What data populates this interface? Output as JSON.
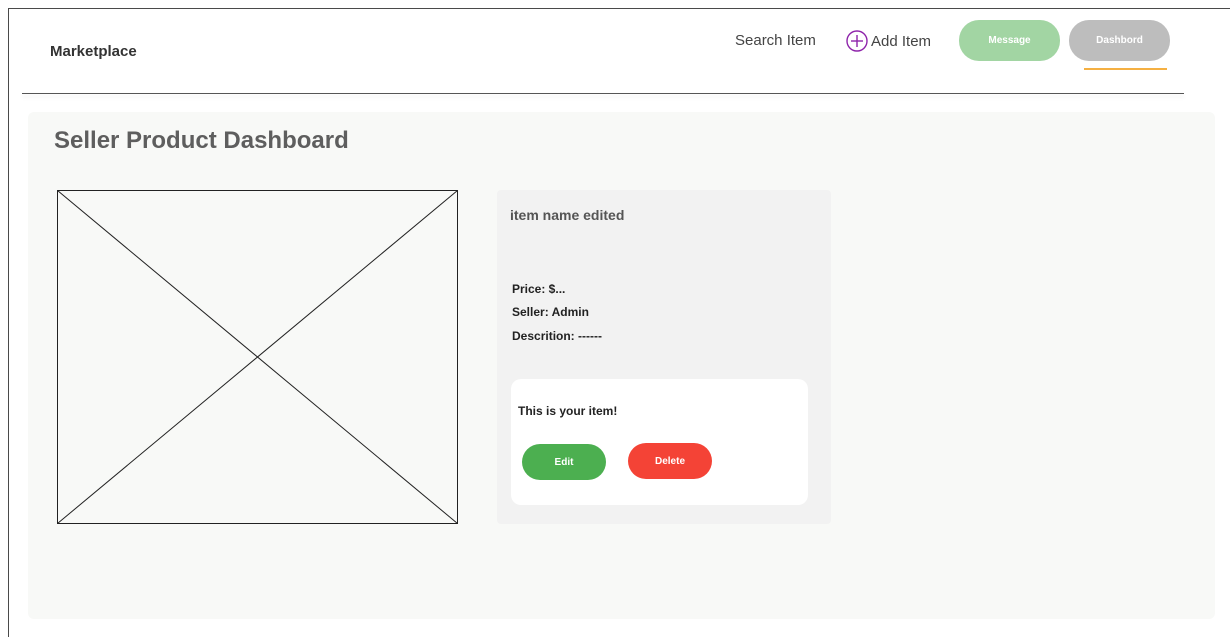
{
  "header": {
    "brand": "Marketplace",
    "search_label": "Search Item",
    "add_item_label": "Add Item",
    "message_label": "Message",
    "dashboard_label": "Dashbord",
    "colors": {
      "message_pill": "#a2d5a3",
      "dashboard_pill": "#bdbdbd",
      "active_underline": "#f5b042",
      "add_icon": "#8e24aa"
    }
  },
  "page": {
    "title": "Seller Product Dashboard"
  },
  "product": {
    "name": "item name edited",
    "price_line": "Price: $...",
    "seller_line": "Seller: Admin",
    "description_line": "Descrition: ------",
    "owner_message": "This is your item!",
    "edit_label": "Edit",
    "delete_label": "Delete",
    "colors": {
      "edit_button": "#4caf50",
      "delete_button": "#f44336"
    }
  },
  "icons": {
    "add_item": "plus-circle-icon",
    "product_image": "image-placeholder-icon"
  }
}
